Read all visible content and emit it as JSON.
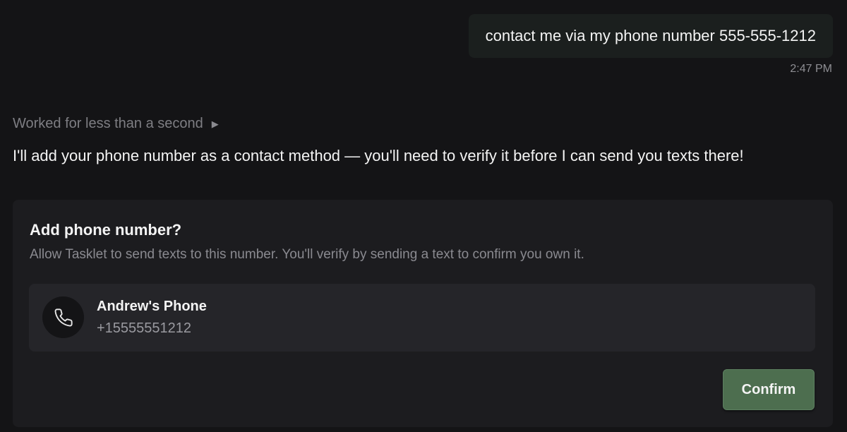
{
  "user_message": {
    "text": "contact me via my phone number 555-555-1212",
    "time": "2:47 PM"
  },
  "assistant": {
    "worked_label": "Worked for less than a second",
    "expand_icon": "triangle-right-icon",
    "message": "I'll add your phone number as a contact method — you'll need to verify it before I can send you texts there!"
  },
  "card": {
    "title": "Add phone number?",
    "description": "Allow Tasklet to send texts to this number. You'll verify by sending a text to confirm you own it.",
    "contact": {
      "icon": "phone-icon",
      "name": "Andrew's Phone",
      "number": "+15555551212"
    },
    "confirm_label": "Confirm"
  },
  "colors": {
    "background": "#141416",
    "card": "#1c1c1f",
    "contact_box": "#252529",
    "confirm_button": "#4d6e4f"
  }
}
